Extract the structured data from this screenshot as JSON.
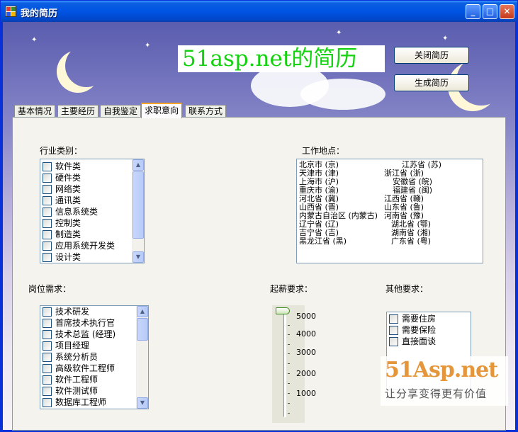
{
  "window": {
    "title": "我的简历"
  },
  "header": {
    "brand_text": "51asp.net的简历",
    "close_button": "关闭简历",
    "generate_button": "生成简历"
  },
  "tabs": [
    {
      "label": "基本情况",
      "active": false
    },
    {
      "label": "主要经历",
      "active": false
    },
    {
      "label": "自我鉴定",
      "active": false
    },
    {
      "label": "求职意向",
      "active": true
    },
    {
      "label": "联系方式",
      "active": false
    }
  ],
  "industry": {
    "label": "行业类别：",
    "items": [
      "软件类",
      "硬件类",
      "网络类",
      "通讯类",
      "信息系统类",
      "控制类",
      "制造类",
      "应用系统开发类",
      "设计类"
    ]
  },
  "location": {
    "label": "工作地点：",
    "rows": [
      [
        "北京市 (京)",
        "江苏省 (苏)"
      ],
      [
        "天津市 (津)",
        "浙江省 (浙)"
      ],
      [
        "上海市 (沪)",
        "安徽省 (皖)"
      ],
      [
        "重庆市 (渝)",
        "福建省 (闽)"
      ],
      [
        "河北省 (冀)",
        "江西省 (赣)"
      ],
      [
        "山西省 (晋)",
        "山东省 (鲁)"
      ],
      [
        "内蒙古自治区 (内蒙古)",
        "河南省 (豫)"
      ],
      [
        "辽宁省 (辽)",
        "湖北省 (鄂)"
      ],
      [
        "吉宁省 (吉)",
        "湖南省 (湘)"
      ],
      [
        "黑龙江省 (黑)",
        "广东省 (粤)"
      ]
    ]
  },
  "position": {
    "label": "岗位需求：",
    "items": [
      "技术研发",
      "首席技术执行官",
      "技术总监 (经理)",
      "项目经理",
      "系统分析员",
      "高级软件工程师",
      "软件工程师",
      "软件测试师",
      "数据库工程师"
    ]
  },
  "salary": {
    "label": "起薪要求：",
    "ticks": [
      "5000",
      "4000",
      "3000",
      "2000",
      "1000"
    ],
    "value": 5000
  },
  "other": {
    "label": "其他要求：",
    "items": [
      "需要住房",
      "需要保险",
      "直接面谈"
    ]
  },
  "watermark": {
    "main": "51Asp.net",
    "slogan": "让分享变得更有价值"
  },
  "colors": {
    "brand_text": "#14d20f",
    "title_bar": "#0054e3",
    "active_tab_accent": "#f5a629"
  }
}
